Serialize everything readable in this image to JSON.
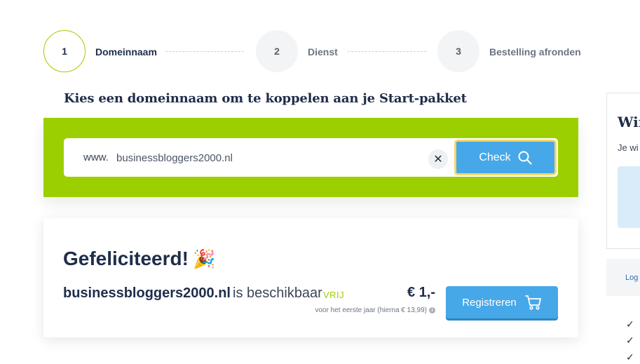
{
  "stepper": {
    "steps": [
      {
        "number": "1",
        "label": "Domeinnaam"
      },
      {
        "number": "2",
        "label": "Dienst"
      },
      {
        "number": "3",
        "label": "Bestelling afronden"
      }
    ]
  },
  "heading": "Kies een domeinnaam om te koppelen aan je Start-pakket",
  "search": {
    "prefix": "www.",
    "value": "businessbloggers2000.nl",
    "clear_label": "✕",
    "check_label": "Check"
  },
  "result": {
    "title": "Gefeliciteerd!",
    "emoji": "🎉",
    "domain": "businessbloggers2000.nl",
    "status": "is beschikbaar",
    "tag": "VRIJ",
    "price": "€ 1,-",
    "price_note": "voor het eerste jaar (hierna € 13,99)",
    "info_icon": "i",
    "register_label": "Registreren"
  },
  "side_panel": {
    "title": "Win",
    "text": "Je wi",
    "login_label": "Log"
  },
  "colors": {
    "accent_green": "#9ccf00",
    "button_blue": "#46a8e8",
    "text_dark": "#1f2d4a"
  }
}
